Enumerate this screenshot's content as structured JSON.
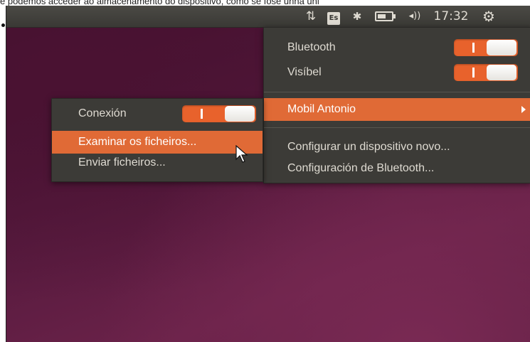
{
  "caption": "e podemos acceder ao almacenamento do dispositivo, como se fose unha uni",
  "panel": {
    "indicators": [
      {
        "icon": "network-updown-icon",
        "glyph": "⇅"
      },
      {
        "icon": "keyboard-layout-icon",
        "label": "Es"
      },
      {
        "icon": "bluetooth-icon",
        "glyph": "✱"
      },
      {
        "icon": "battery-icon",
        "fill": 0.6
      },
      {
        "icon": "volume-icon",
        "glyph": "◂))"
      }
    ],
    "clock": "17:32",
    "settings_icon": "gear-icon"
  },
  "bluetooth_menu": {
    "bluetooth_label": "Bluetooth",
    "bluetooth_on": true,
    "visible_label": "Visíbel",
    "visible_on": true,
    "device_label": "Mobil Antonio",
    "setup_label": "Configurar un dispositivo novo...",
    "settings_label": "Configuración de Bluetooth..."
  },
  "device_submenu": {
    "connection_label": "Conexión",
    "connection_on": true,
    "browse_label": "Examinar os ficheiros...",
    "send_label": "Enviar ficheiros..."
  },
  "colors": {
    "accent": "#e06a36",
    "panel": "#3c3b37",
    "desktop": "#5b1d40"
  }
}
